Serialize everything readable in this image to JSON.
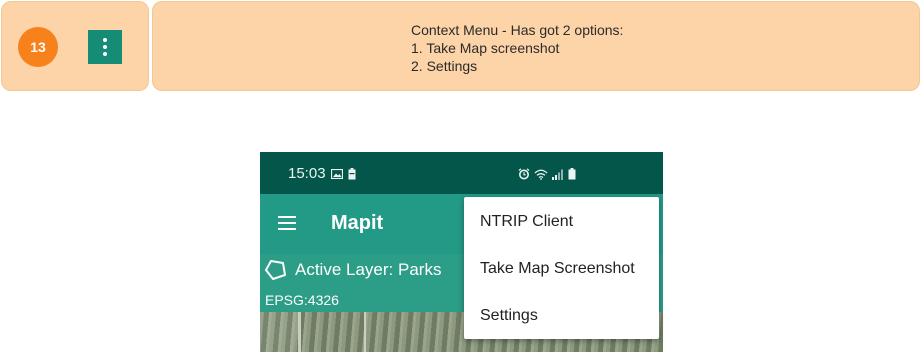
{
  "annotation": {
    "step_number": "13",
    "kebab_icon": "more-vert-icon",
    "lines": [
      "Context Menu - Has got 2 options:",
      "1. Take Map screenshot",
      "2. Settings"
    ]
  },
  "status_bar": {
    "time": "15:03",
    "left_icons": [
      "image-icon",
      "battery-saver-icon"
    ],
    "right_icons": [
      "alarm-icon",
      "wifi-icon",
      "signal-icon",
      "battery-icon"
    ]
  },
  "app_bar": {
    "menu_icon": "hamburger-icon",
    "title": "Mapit"
  },
  "layer_banner": {
    "icon": "polygon-icon",
    "active_layer": "Active Layer: Parks",
    "epsg": "EPSG:4326"
  },
  "context_menu": {
    "items": [
      {
        "label": "NTRIP Client"
      },
      {
        "label": "Take Map Screenshot"
      },
      {
        "label": "Settings"
      }
    ]
  },
  "colors": {
    "annotation_bg": "#fdd3a8",
    "step_badge": "#f7821b",
    "kebab_bg": "#168b75",
    "status_bar": "#05564a",
    "app_bar": "#239a86"
  }
}
